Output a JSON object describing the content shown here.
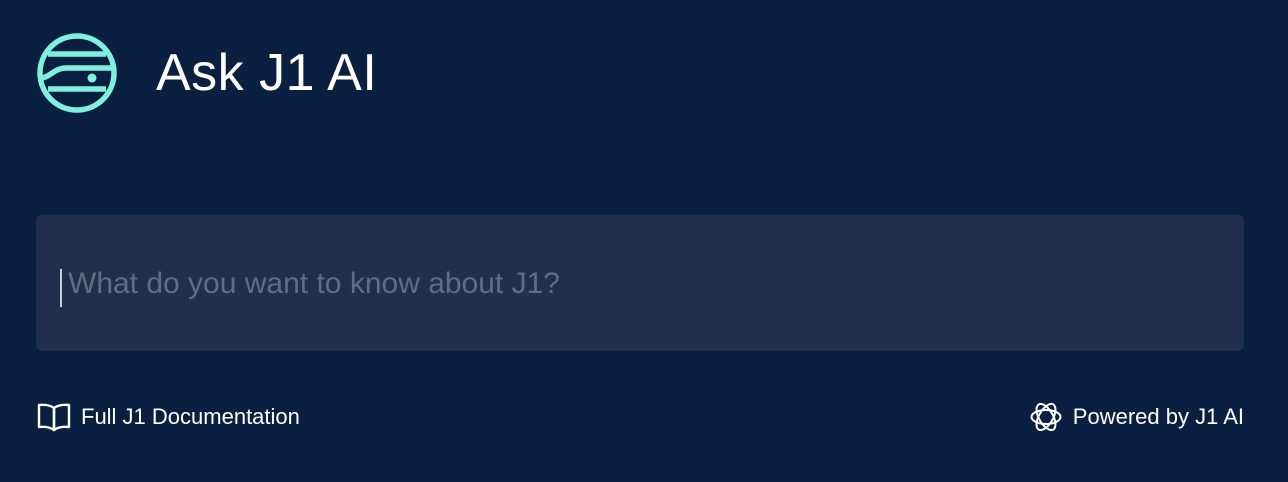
{
  "header": {
    "title": "Ask J1 AI",
    "logo_icon": "planet-logo-icon",
    "logo_color": "#7ff0df"
  },
  "search": {
    "placeholder": "What do you want to know about J1?",
    "value": ""
  },
  "footer": {
    "docs_link_label": "Full J1 Documentation",
    "docs_icon": "book-icon",
    "powered_label": "Powered by J1 AI",
    "powered_icon": "openai-knot-icon"
  },
  "colors": {
    "background": "#0b1f41",
    "input_background": "#212f4d",
    "placeholder": "#5d6e85",
    "text": "#ffffff"
  }
}
